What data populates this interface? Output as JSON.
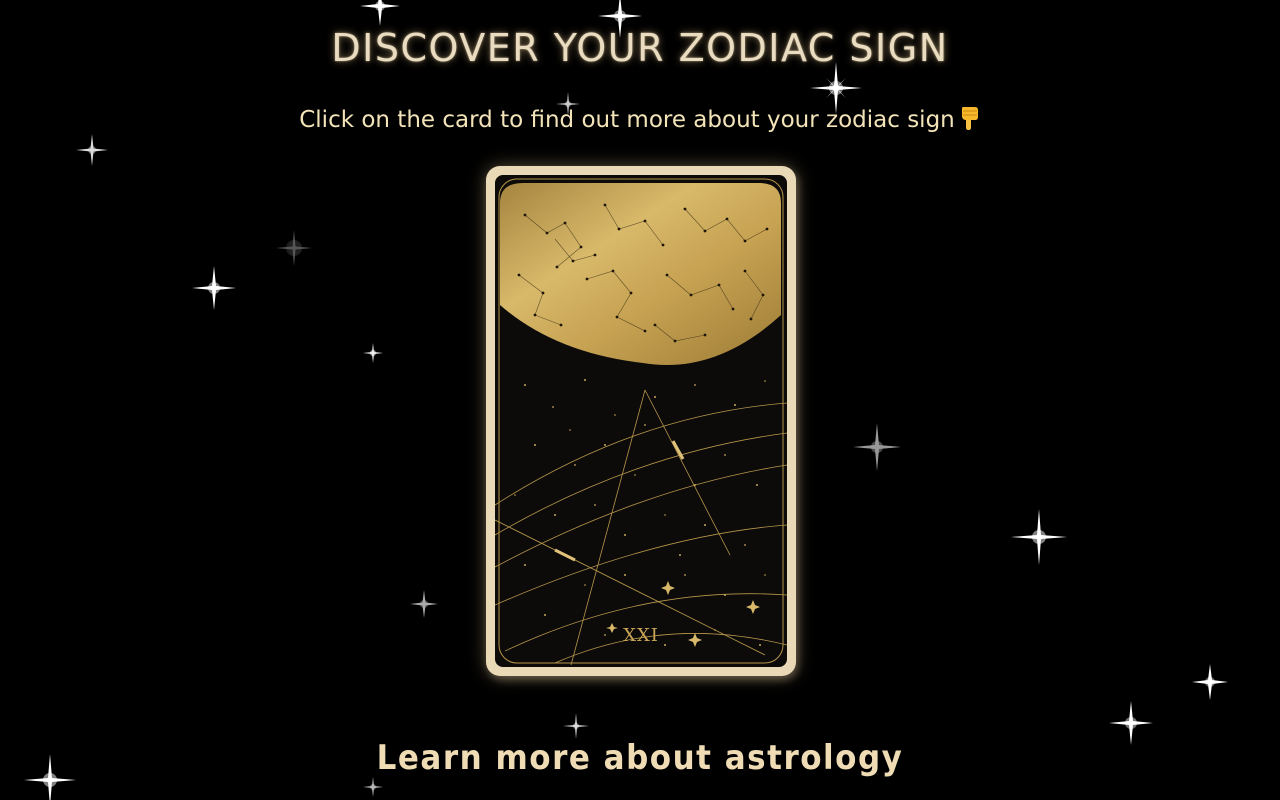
{
  "header": {
    "title": "DISCOVER YOUR ZODIAC SIGN",
    "subtitle": "Click on the card to find out more about your zodiac sign"
  },
  "card": {
    "numeral": "XXI",
    "icon": "constellation-moon-card"
  },
  "footer": {
    "link_label": "Learn more about astrology"
  },
  "colors": {
    "background": "#000000",
    "gold": "#c8a655",
    "card_border": "#e9d9b6",
    "title": "#e9dcc0",
    "subtitle": "#f3e3b8"
  },
  "icons": {
    "pointer": "hand-pointing-down-icon",
    "stars": "sparkle-icon"
  }
}
